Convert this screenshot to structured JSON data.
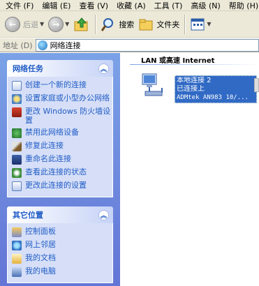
{
  "menu": [
    "文件 (F)",
    "编辑 (E)",
    "查看 (V)",
    "收藏 (A)",
    "工具 (T)",
    "高级 (N)",
    "帮助 (H)"
  ],
  "toolbar": {
    "back_label": "后退",
    "search_label": "搜索",
    "folders_label": "文件夹"
  },
  "address": {
    "label": "地址 (D)",
    "value": "网络连接"
  },
  "network_tasks": {
    "title": "网络任务",
    "items": [
      "创建一个新的连接",
      "设置家庭或小型办公网络",
      "更改 Windows 防火墙设置",
      "禁用此网络设备",
      "修复此连接",
      "重命名此连接",
      "查看此连接的状态",
      "更改此连接的设置"
    ]
  },
  "other_places": {
    "title": "其它位置",
    "items": [
      "控制面板",
      "网上邻居",
      "我的文档",
      "我的电脑"
    ]
  },
  "content": {
    "group_header": "LAN 或高速 Internet",
    "connection": {
      "name": "本地连接 2",
      "status": "已连接上",
      "device": "ADMtek AN983 10/..."
    }
  }
}
